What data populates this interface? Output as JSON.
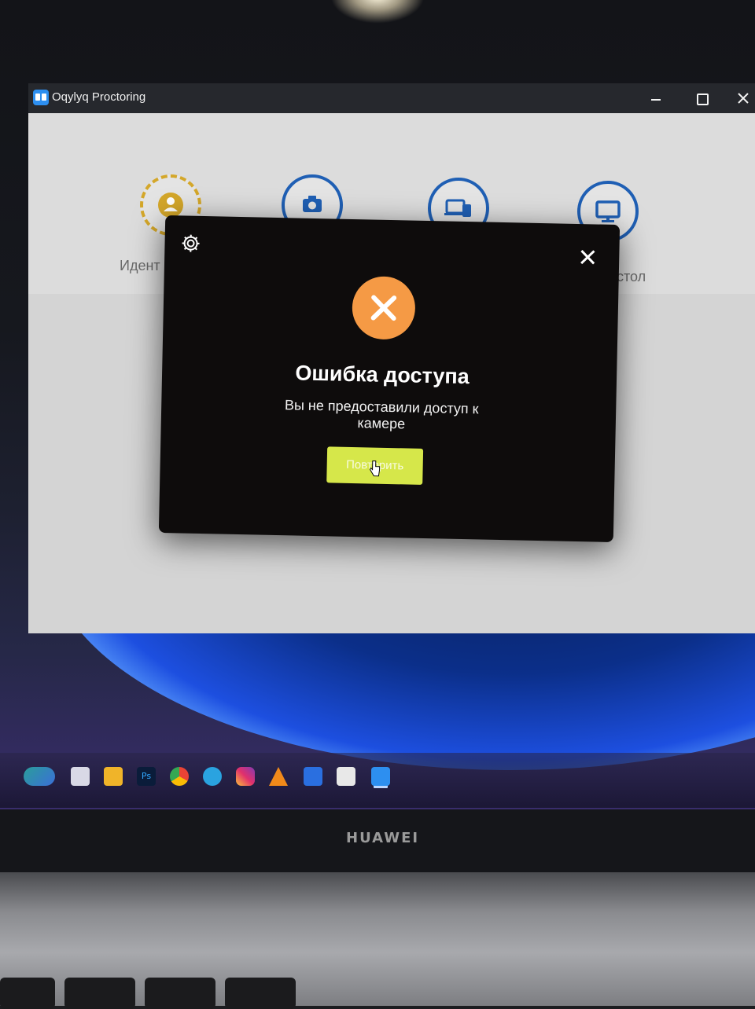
{
  "window": {
    "title": "Oqylyq Proctoring",
    "controls": [
      "minimize",
      "maximize",
      "close"
    ]
  },
  "steps": [
    {
      "icon": "user-icon",
      "label": "Идент",
      "state": "active"
    },
    {
      "icon": "camera-icon",
      "label": "",
      "state": "pending"
    },
    {
      "icon": "devices-icon",
      "label": "",
      "state": "pending"
    },
    {
      "icon": "monitor-icon",
      "label": "стол",
      "state": "pending"
    }
  ],
  "modal": {
    "icon": "error-x-icon",
    "title": "Ошибка доступа",
    "message": "Вы не предоставили доступ к камере",
    "retry_label": "Повторить",
    "settings_icon": "gear-icon",
    "close_icon": "close-icon"
  },
  "taskbar": {
    "apps": [
      "edge-icon",
      "files-icon",
      "explorer-icon",
      "photoshop-icon",
      "chrome-icon",
      "telegram-icon",
      "instagram-icon",
      "vlc-icon",
      "media-icon",
      "snipping-icon",
      "oqylyq-icon"
    ]
  },
  "device": {
    "brand": "HUAWEI"
  },
  "colors": {
    "accent_blue": "#1f5fb4",
    "active_step": "#d4a72a",
    "error_orange": "#f59a45",
    "retry_button": "#d6e74a",
    "modal_bg": "#0e0c0c"
  }
}
